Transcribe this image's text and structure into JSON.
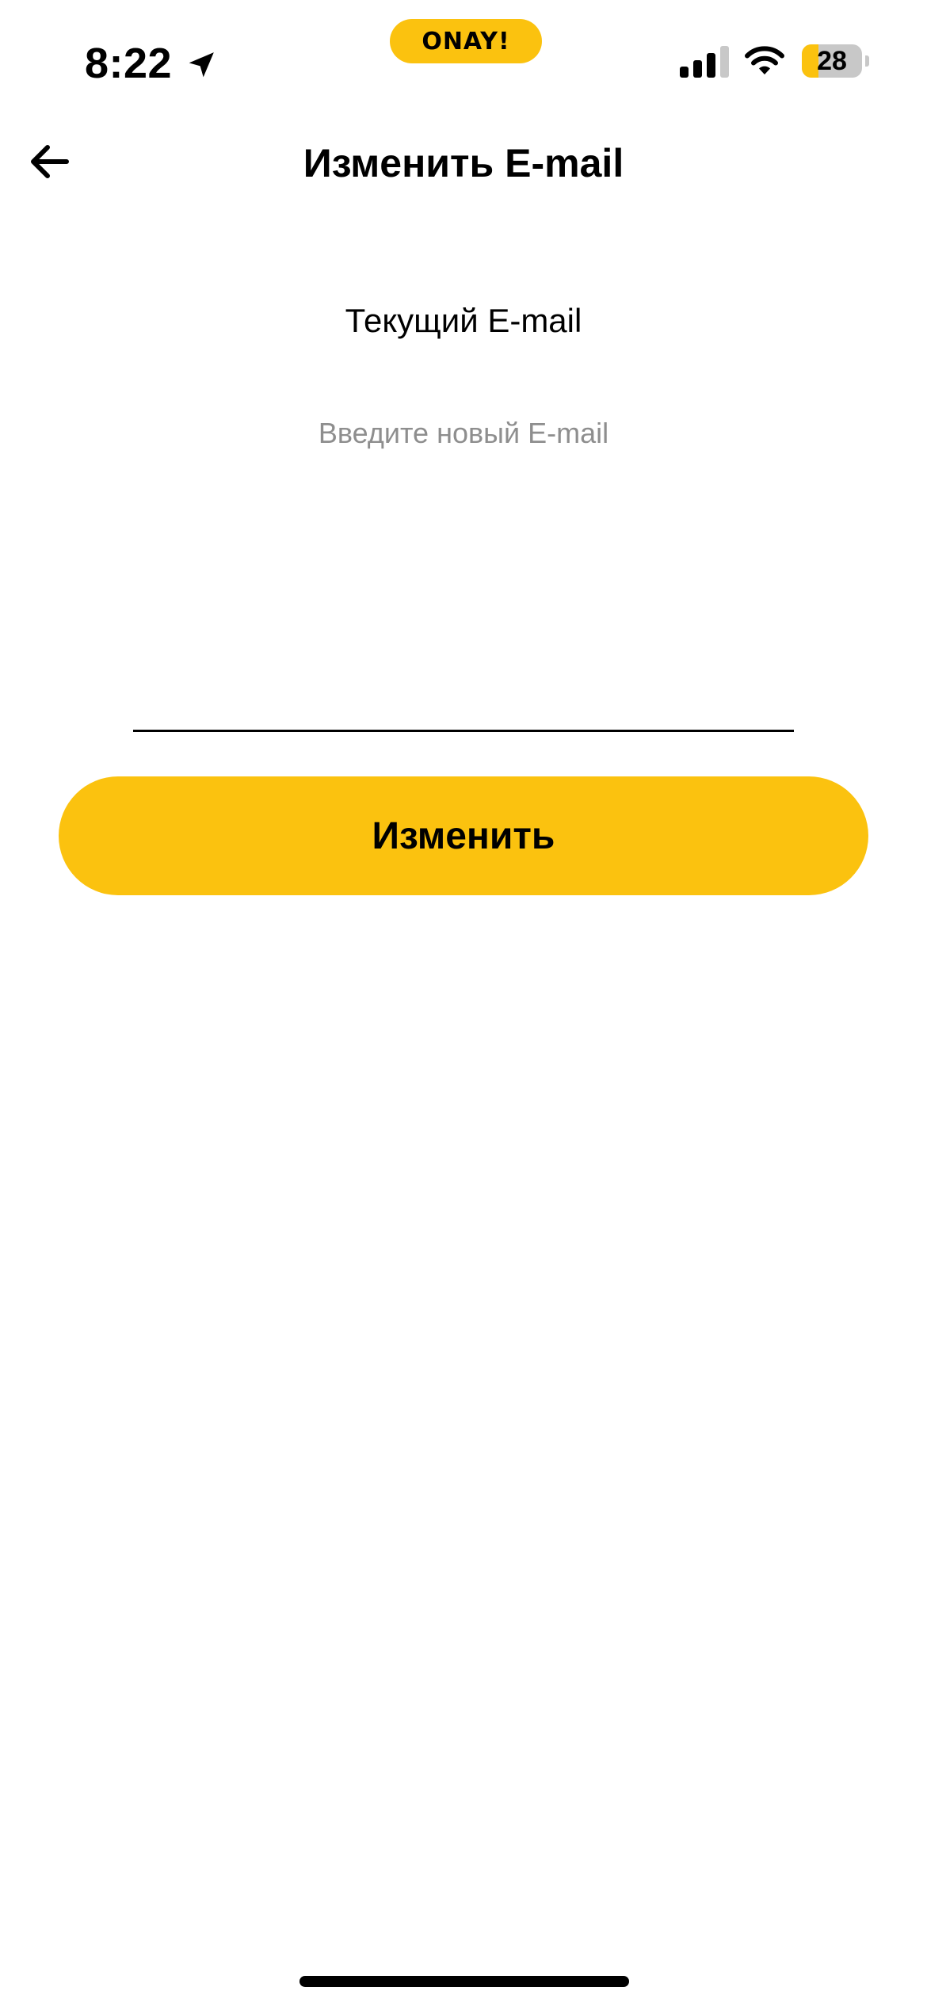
{
  "status_bar": {
    "time": "8:22",
    "location_icon": "location-arrow-icon",
    "app_pill_label": "ONAY!",
    "signal_icon": "cellular-signal-icon",
    "wifi_icon": "wifi-icon",
    "battery_level": "28",
    "battery_fraction": 0.28
  },
  "header": {
    "back_icon": "arrow-left-icon",
    "title": "Изменить E-mail"
  },
  "form": {
    "current_email_label": "Текущий E-mail",
    "new_email_placeholder": "Введите новый E-mail",
    "new_email_value": "",
    "submit_label": "Изменить"
  },
  "colors": {
    "accent": "#fbc20f",
    "text": "#000000",
    "placeholder": "#8e8e8e",
    "background": "#ffffff"
  }
}
